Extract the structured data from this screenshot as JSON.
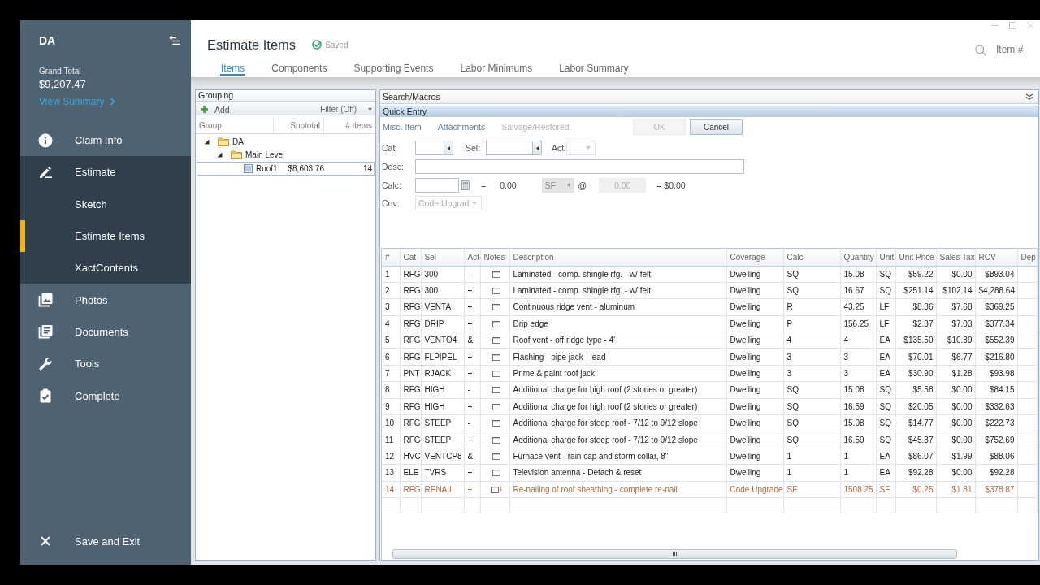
{
  "sidebar": {
    "title": "DA",
    "grand_total_label": "Grand Total",
    "grand_total": "$9,207.47",
    "summary_link": "View Summary",
    "items": [
      {
        "label": "Claim Info",
        "selected": false
      },
      {
        "label": "Estimate",
        "selected": false,
        "expanded": true,
        "children": [
          {
            "label": "Sketch",
            "selected": false
          },
          {
            "label": "Estimate Items",
            "selected": true
          },
          {
            "label": "XactContents",
            "selected": false
          }
        ]
      },
      {
        "label": "Photos",
        "selected": false
      },
      {
        "label": "Documents",
        "selected": false
      },
      {
        "label": "Tools",
        "selected": false
      },
      {
        "label": "Complete",
        "selected": false
      }
    ],
    "exit": "Save and Exit"
  },
  "header": {
    "title": "Estimate Items",
    "status": "Saved",
    "tabs": [
      {
        "label": "Items",
        "selected": true
      },
      {
        "label": "Components",
        "selected": false
      },
      {
        "label": "Supporting Events",
        "selected": false
      },
      {
        "label": "Labor Minimums",
        "selected": false
      },
      {
        "label": "Labor Summary",
        "selected": false
      }
    ],
    "search": {
      "placeholder": "Item #"
    }
  },
  "grouping": {
    "title": "Grouping",
    "add": "Add",
    "filter": "Filter (Off)",
    "columns": [
      "Group",
      "Subtotal",
      "# Items"
    ],
    "tree": [
      {
        "label": "DA",
        "expanded": true,
        "selected": false,
        "children": [
          {
            "label": "Main Level",
            "expanded": true,
            "selected": false,
            "children": [
              {
                "label": "Roof1",
                "subtotal": "$8,603.76",
                "items": "14",
                "selected": true
              }
            ]
          }
        ]
      }
    ]
  },
  "search_macros": {
    "title": "Search/Macros"
  },
  "quick_entry": {
    "title": "Quick Entry",
    "links": [
      {
        "label": "Misc. Item",
        "disabled": false
      },
      {
        "label": "Attachments",
        "disabled": false
      },
      {
        "label": "Salvage/Restored",
        "disabled": true
      }
    ],
    "buttons": [
      {
        "label": "OK",
        "disabled": true
      },
      {
        "label": "Cancel",
        "disabled": false
      }
    ],
    "cat": {
      "label": "Cat:"
    },
    "sel": {
      "label": "Sel:"
    },
    "act": {
      "label": "Act:",
      "disabled": true
    },
    "desc": {
      "label": "Desc:"
    },
    "calc": {
      "label": "Calc:",
      "equals": "=",
      "quantity": "0.00",
      "unit": {
        "value": "SF",
        "disabled": true
      },
      "at": "@",
      "unit_price": {
        "value": "0.00",
        "disabled": true
      },
      "total": "= $0.00"
    },
    "cov": {
      "label": "Cov:",
      "value": "Code Upgrad",
      "disabled": true
    }
  },
  "table": {
    "columns": [
      "#",
      "Cat",
      "Sel",
      "Act",
      "Notes",
      "Description",
      "Coverage",
      "Calc",
      "Quantity",
      "Unit",
      "Unit Price",
      "Sales Tax",
      "RCV",
      "Dep"
    ],
    "rows": [
      {
        "number": "1",
        "cat": "RFG",
        "sel": "300",
        "act": "-",
        "description": "Laminated - comp. shingle rfg. - w/ felt",
        "coverage": "Dwelling",
        "calc": "SQ",
        "quantity": "15.08",
        "unit": "SQ",
        "unit_price": "$59.22",
        "sales_tax": "$0.00",
        "rcv": "$893.04",
        "color": "#222222"
      },
      {
        "number": "2",
        "cat": "RFG",
        "sel": "300",
        "act": "+",
        "description": "Laminated - comp. shingle rfg. - w/ felt",
        "coverage": "Dwelling",
        "calc": "SQ",
        "quantity": "16.67",
        "unit": "SQ",
        "unit_price": "$251.14",
        "sales_tax": "$102.14",
        "rcv": "$4,288.64",
        "color": "#222222"
      },
      {
        "number": "3",
        "cat": "RFG",
        "sel": "VENTA",
        "act": "+",
        "description": "Continuous ridge vent - aluminum",
        "coverage": "Dwelling",
        "calc": "R",
        "quantity": "43.25",
        "unit": "LF",
        "unit_price": "$8.36",
        "sales_tax": "$7.68",
        "rcv": "$369.25",
        "color": "#222222"
      },
      {
        "number": "4",
        "cat": "RFG",
        "sel": "DRIP",
        "act": "+",
        "description": "Drip edge",
        "coverage": "Dwelling",
        "calc": "P",
        "quantity": "156.25",
        "unit": "LF",
        "unit_price": "$2.37",
        "sales_tax": "$7.03",
        "rcv": "$377.34",
        "color": "#222222"
      },
      {
        "number": "5",
        "cat": "RFG",
        "sel": "VENTO4",
        "act": "&",
        "description": "Roof vent - off ridge type - 4'",
        "coverage": "Dwelling",
        "calc": "4",
        "quantity": "4",
        "unit": "EA",
        "unit_price": "$135.50",
        "sales_tax": "$10.39",
        "rcv": "$552.39",
        "color": "#222222"
      },
      {
        "number": "6",
        "cat": "RFG",
        "sel": "FLPIPEL",
        "act": "+",
        "description": "Flashing - pipe jack - lead",
        "coverage": "Dwelling",
        "calc": "3",
        "quantity": "3",
        "unit": "EA",
        "unit_price": "$70.01",
        "sales_tax": "$6.77",
        "rcv": "$216.80",
        "color": "#222222"
      },
      {
        "number": "7",
        "cat": "PNT",
        "sel": "RJACK",
        "act": "+",
        "description": "Prime & paint roof jack",
        "coverage": "Dwelling",
        "calc": "3",
        "quantity": "3",
        "unit": "EA",
        "unit_price": "$30.90",
        "sales_tax": "$1.28",
        "rcv": "$93.98",
        "color": "#222222"
      },
      {
        "number": "8",
        "cat": "RFG",
        "sel": "HIGH",
        "act": "-",
        "description": "Additional charge for high roof (2 stories or greater)",
        "coverage": "Dwelling",
        "calc": "SQ",
        "quantity": "15.08",
        "unit": "SQ",
        "unit_price": "$5.58",
        "sales_tax": "$0.00",
        "rcv": "$84.15",
        "color": "#222222"
      },
      {
        "number": "9",
        "cat": "RFG",
        "sel": "HIGH",
        "act": "+",
        "description": "Additional charge for high roof (2 stories or greater)",
        "coverage": "Dwelling",
        "calc": "SQ",
        "quantity": "16.59",
        "unit": "SQ",
        "unit_price": "$20.05",
        "sales_tax": "$0.00",
        "rcv": "$332.63",
        "color": "#222222"
      },
      {
        "number": "10",
        "cat": "RFG",
        "sel": "STEEP",
        "act": "-",
        "description": "Additional charge for steep roof - 7/12 to 9/12 slope",
        "coverage": "Dwelling",
        "calc": "SQ",
        "quantity": "15.08",
        "unit": "SQ",
        "unit_price": "$14.77",
        "sales_tax": "$0.00",
        "rcv": "$222.73",
        "color": "#222222"
      },
      {
        "number": "11",
        "cat": "RFG",
        "sel": "STEEP",
        "act": "+",
        "description": "Additional charge for steep roof - 7/12 to 9/12 slope",
        "coverage": "Dwelling",
        "calc": "SQ",
        "quantity": "16.59",
        "unit": "SQ",
        "unit_price": "$45.37",
        "sales_tax": "$0.00",
        "rcv": "$752.69",
        "color": "#222222"
      },
      {
        "number": "12",
        "cat": "HVC",
        "sel": "VENTCP8",
        "act": "&",
        "description": "Furnace vent - rain cap and storm collar, 8\"",
        "coverage": "Dwelling",
        "calc": "1",
        "quantity": "1",
        "unit": "EA",
        "unit_price": "$86.07",
        "sales_tax": "$1.99",
        "rcv": "$88.06",
        "color": "#222222"
      },
      {
        "number": "13",
        "cat": "ELE",
        "sel": "TVRS",
        "act": "+",
        "description": "Television antenna - Detach & reset",
        "coverage": "Dwelling",
        "calc": "1",
        "quantity": "1",
        "unit": "EA",
        "unit_price": "$92.28",
        "sales_tax": "$0.00",
        "rcv": "$92.28",
        "color": "#222222"
      },
      {
        "number": "14",
        "cat": "RFG",
        "sel": "RENAIL",
        "act": "+",
        "note_count": "1",
        "description": "Re-nailing of roof sheathing - complete re-nail",
        "coverage": "Code Upgrade",
        "calc": "SF",
        "quantity": "1508.25",
        "unit": "SF",
        "unit_price": "$0.25",
        "sales_tax": "$1.81",
        "rcv": "$378.87",
        "color": "#b26b44"
      }
    ]
  }
}
